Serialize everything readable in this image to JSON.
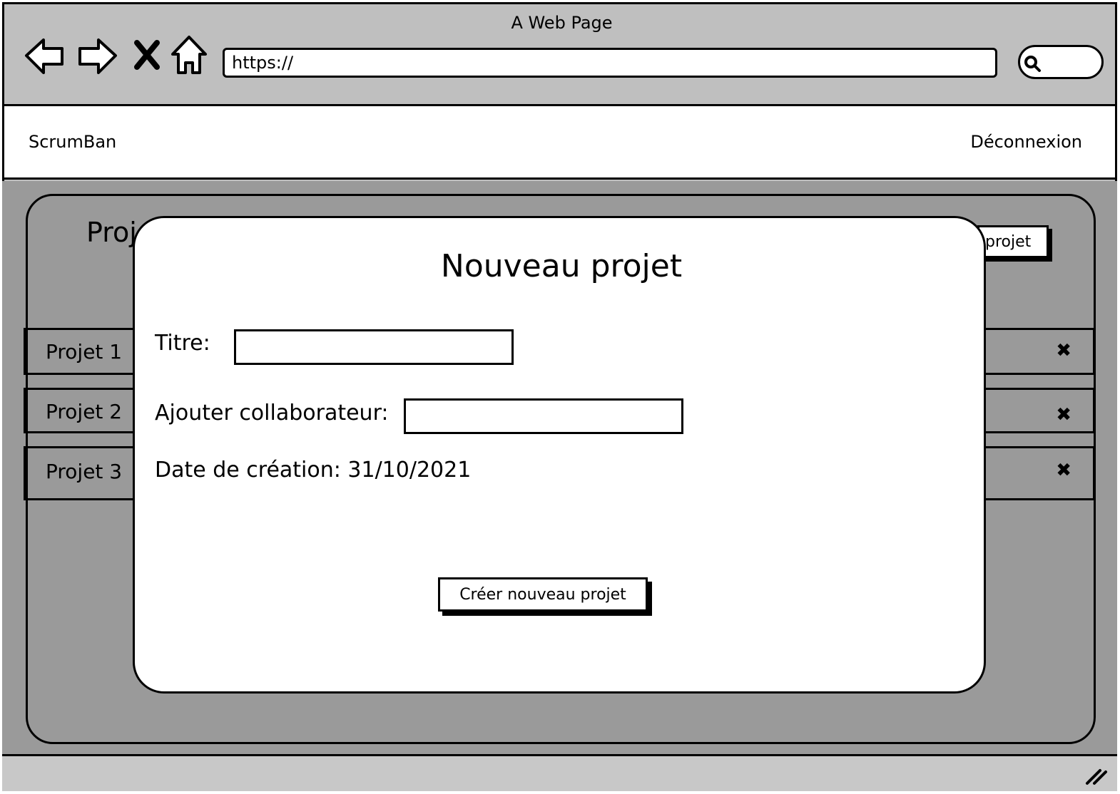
{
  "browser": {
    "title": "A Web Page",
    "url": "https://"
  },
  "header": {
    "brand": "ScrumBan",
    "logout": "Déconnexion"
  },
  "projects_panel": {
    "title_visible": "Proj",
    "new_button_visible": "projet",
    "rows": [
      {
        "label": "Projet 1",
        "close": "✖"
      },
      {
        "label": "Projet 2",
        "close": "✖"
      },
      {
        "label": "Projet 3",
        "close": "✖"
      }
    ]
  },
  "modal": {
    "title": "Nouveau projet",
    "title_label": "Titre:",
    "title_value": "",
    "collab_label": "Ajouter collaborateur:",
    "collab_value": "",
    "date_text": "Date de création: 31/10/2021",
    "submit_label": "Créer nouveau projet"
  }
}
